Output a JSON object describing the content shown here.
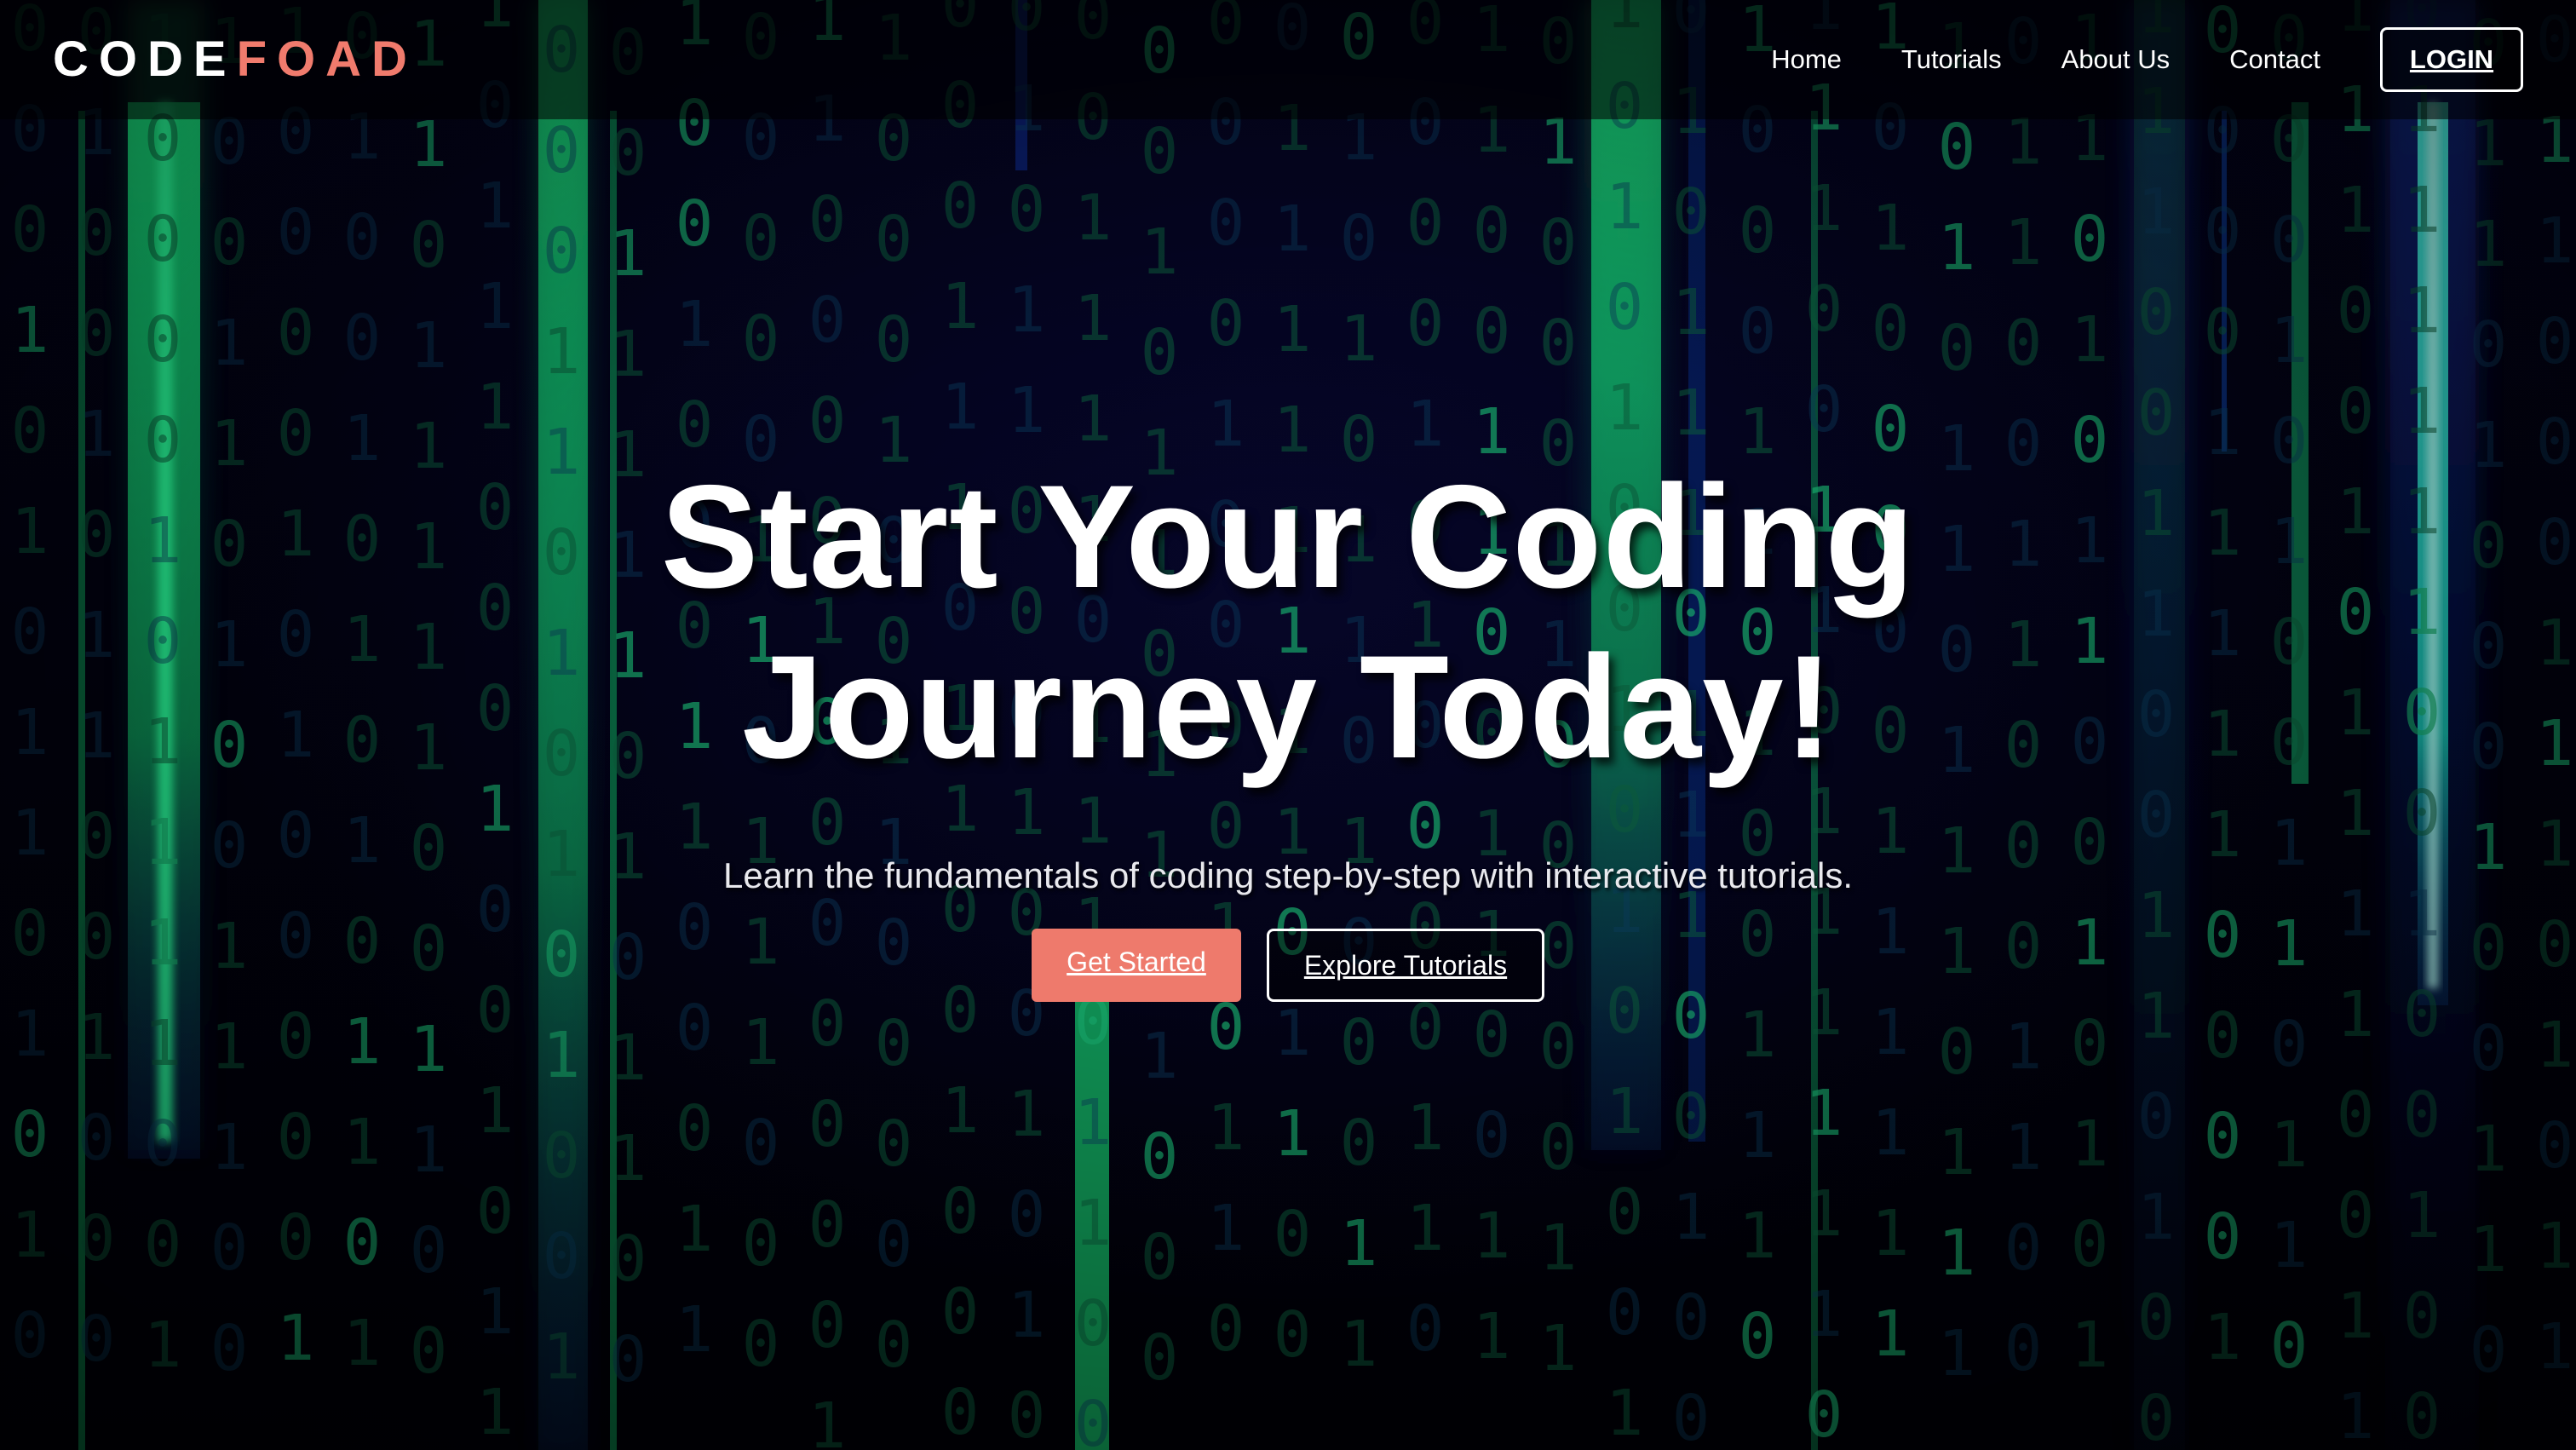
{
  "header": {
    "logo_part_1": "CODE",
    "logo_part_2": "FOAD",
    "nav": [
      {
        "label": "Home"
      },
      {
        "label": "Tutorials"
      },
      {
        "label": "About Us"
      },
      {
        "label": "Contact"
      }
    ],
    "login_label": "LOGIN"
  },
  "hero": {
    "title_line_1": "Start Your Coding",
    "title_line_2": "Journey Today!",
    "subtitle": "Learn the fundamentals of coding step-by-step with interactive tutorials.",
    "primary_cta": "Get Started",
    "secondary_cta": "Explore Tutorials"
  },
  "colors": {
    "accent": "#ee7a6c",
    "matrix_green": "#19d67a",
    "matrix_cyan": "#29f2e0",
    "background": "#01010f"
  }
}
